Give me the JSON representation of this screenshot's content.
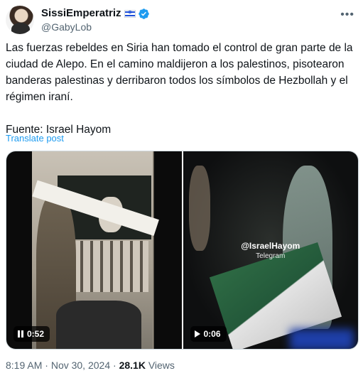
{
  "author": {
    "display_name": "SissiEmperatriz",
    "handle": "@GabyLob",
    "flag_icon": "israel-flag-icon",
    "verified_icon": "verified-badge-icon",
    "verified_color": "#1d9bf0"
  },
  "more_icon": "more-dots-icon",
  "tweet": {
    "text": "Las fuerzas rebeldes en Siria han tomado el control de gran parte de la ciudad de Alepo. En el camino maldijeron a los palestinos, pisotearon banderas palestinas y derribaron todos los símbolos de Hezbollah y el régimen iraní.\n\nFuente: Israel Hayom",
    "translate_label": "Translate post"
  },
  "media": [
    {
      "duration": "0:52",
      "state_icon": "pause-icon"
    },
    {
      "duration": "0:06",
      "state_icon": "play-icon",
      "watermark": "@IsraelHayom",
      "watermark_sub": "Telegram"
    }
  ],
  "meta": {
    "time": "8:19 AM",
    "separator": "·",
    "date": "Nov 30, 2024",
    "views_count": "28.1K",
    "views_label": "Views"
  }
}
